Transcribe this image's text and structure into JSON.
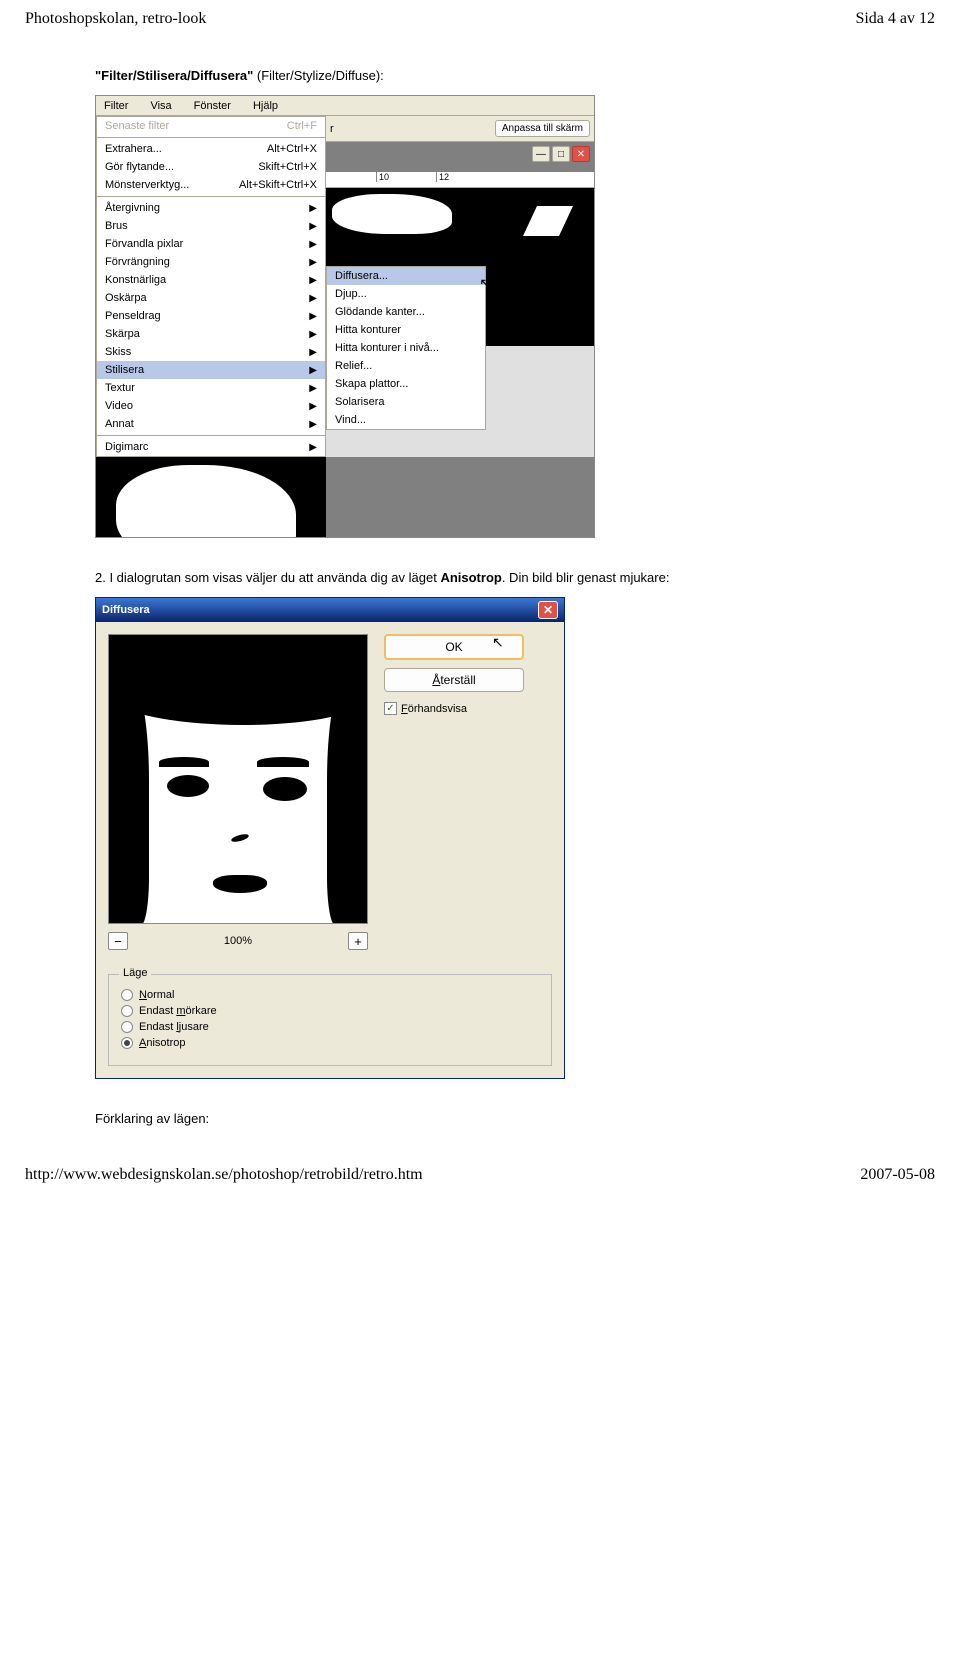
{
  "header": {
    "left": "Photoshopskolan, retro-look",
    "right": "Sida 4 av 12"
  },
  "footer": {
    "left": "http://www.webdesignskolan.se/photoshop/retrobild/retro.htm",
    "right": "2007-05-08"
  },
  "instruction1": {
    "bold": "\"Filter/Stilisera/Diffusera\"",
    "rest": " (Filter/Stylize/Diffuse):"
  },
  "instruction2": {
    "pre": "2.  I dialogrutan som visas väljer du att använda dig av läget ",
    "bold": "Anisotrop",
    "post": ". Din bild blir genast mjukare:"
  },
  "menubar": [
    "Filter",
    "Visa",
    "Fönster",
    "Hjälp"
  ],
  "toolbar_btn": "Anpassa till skärm",
  "ruler": [
    "10",
    "12"
  ],
  "filter_menu": {
    "recent": {
      "label": "Senaste filter",
      "shortcut": "Ctrl+F"
    },
    "extract": {
      "label": "Extrahera...",
      "shortcut": "Alt+Ctrl+X"
    },
    "liquify": {
      "label": "Gör flytande...",
      "shortcut": "Skift+Ctrl+X"
    },
    "pattern": {
      "label": "Mönsterverktyg...",
      "shortcut": "Alt+Skift+Ctrl+X"
    },
    "groups": [
      "Återgivning",
      "Brus",
      "Förvandla pixlar",
      "Förvrängning",
      "Konstnärliga",
      "Oskärpa",
      "Penseldrag",
      "Skärpa",
      "Skiss",
      "Stilisera",
      "Textur",
      "Video",
      "Annat"
    ],
    "digimarc": "Digimarc"
  },
  "stilisera_submenu": [
    "Diffusera...",
    "Djup...",
    "Glödande kanter...",
    "Hitta konturer",
    "Hitta konturer i nivå...",
    "Relief...",
    "Skapa plattor...",
    "Solarisera",
    "Vind..."
  ],
  "dialog": {
    "title": "Diffusera",
    "ok": "OK",
    "reset": "Återställ",
    "reset_ul": "Å",
    "preview_label": "Förhandsvisa",
    "preview_ul": "F",
    "zoom": "100%",
    "group_label": "Läge",
    "modes": {
      "normal": "Normal",
      "normal_ul": "N",
      "dark": "Endast mörkare",
      "dark_ul": "m",
      "light": "Endast ljusare",
      "light_ul": "l",
      "aniso": "Anisotrop",
      "aniso_ul": "A"
    }
  },
  "label_forklaring": "Förklaring av lägen:"
}
